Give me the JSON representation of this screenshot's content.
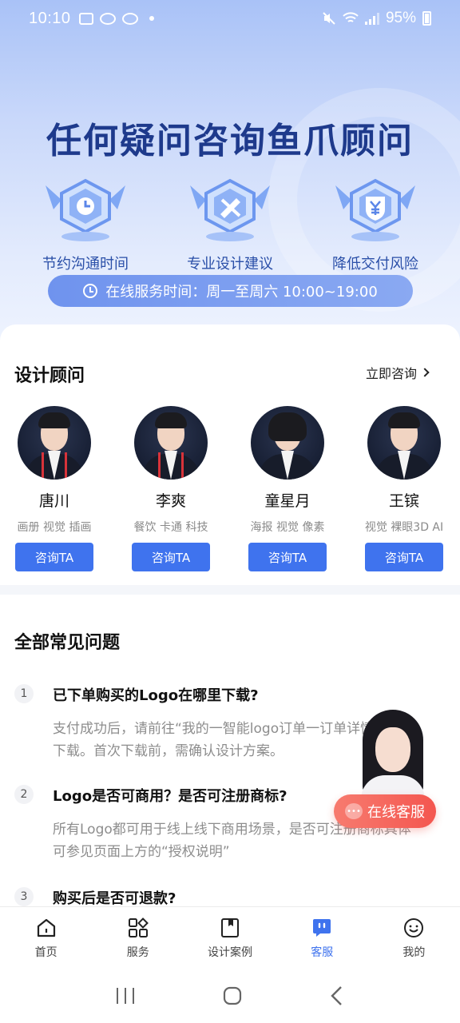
{
  "status_bar": {
    "time": "10:10",
    "battery": "95%"
  },
  "hero": {
    "title": "任何疑问咨询鱼爪顾问",
    "features": [
      {
        "label": "节约沟通时间",
        "icon": "clock-badge-icon"
      },
      {
        "label": "专业设计建议",
        "icon": "ruler-pencil-badge-icon"
      },
      {
        "label": "降低交付风险",
        "icon": "yen-shield-badge-icon"
      }
    ],
    "service_hours": "在线服务时间：周一至周六 10:00~19:00"
  },
  "consultants": {
    "title": "设计顾问",
    "more_label": "立即咨询",
    "button_label": "咨询TA",
    "items": [
      {
        "name": "唐川",
        "tags": "画册 视觉 插画"
      },
      {
        "name": "李爽",
        "tags": "餐饮 卡通 科技"
      },
      {
        "name": "童星月",
        "tags": "海报 视觉 像素"
      },
      {
        "name": "王镔",
        "tags": "视觉 裸眼3D AI"
      }
    ]
  },
  "faq": {
    "title": "全部常见问题",
    "items": [
      {
        "num": "1",
        "question": "已下单购买的Logo在哪里下载?",
        "answer": "支付成功后，请前往“我的一智能logo订单一订单详情”进行下载。首次下载前，需确认设计方案。"
      },
      {
        "num": "2",
        "question": "Logo是否可商用？是否可注册商标?",
        "answer": "所有Logo都可用于线上线下商用场景，是否可注册商标具体可参见页面上方的“授权说明”"
      },
      {
        "num": "3",
        "question": "购买后是否可退款?",
        "answer": ""
      }
    ]
  },
  "floating_service": {
    "label": "在线客服"
  },
  "tabbar": {
    "items": [
      {
        "label": "首页",
        "icon": "home-icon",
        "active": false
      },
      {
        "label": "服务",
        "icon": "grid-icon",
        "active": false
      },
      {
        "label": "设计案例",
        "icon": "bookmark-icon",
        "active": false
      },
      {
        "label": "客服",
        "icon": "chat-icon",
        "active": true
      },
      {
        "label": "我的",
        "icon": "smile-icon",
        "active": false
      }
    ]
  },
  "colors": {
    "accent": "#3f73ee",
    "hero_title": "#1e3a8c",
    "online_service": "#f4564f"
  }
}
